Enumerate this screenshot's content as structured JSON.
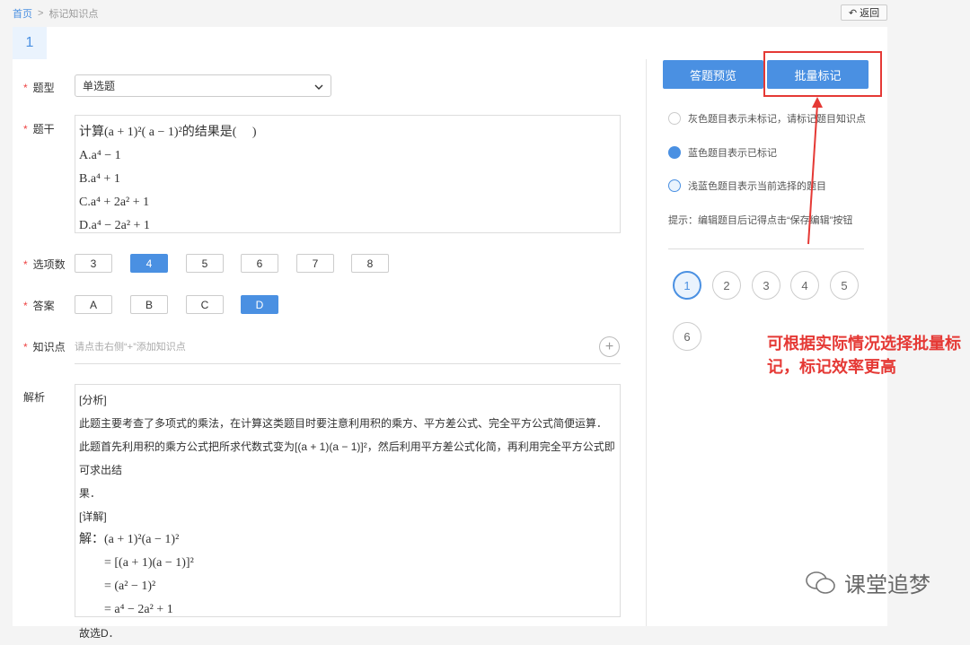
{
  "breadcrumb": {
    "home": "首页",
    "sep": ">",
    "current": "标记知识点"
  },
  "back_button": {
    "icon": "undo-icon",
    "label": "返回"
  },
  "question_tab": "1",
  "form": {
    "type": {
      "label": "题型",
      "value": "单选题"
    },
    "stem": {
      "label": "题干",
      "lines": [
        "计算(a + 1)²( a − 1)²的结果是(　 )",
        "A.a⁴ − 1",
        "B.a⁴ + 1",
        "C.a⁴ + 2a² + 1",
        "D.a⁴ − 2a² + 1"
      ]
    },
    "option_count": {
      "label": "选项数",
      "options": [
        "3",
        "4",
        "5",
        "6",
        "7",
        "8"
      ],
      "selected": "4"
    },
    "answer": {
      "label": "答案",
      "options": [
        "A",
        "B",
        "C",
        "D"
      ],
      "selected": "D"
    },
    "knowledge": {
      "label": "知识点",
      "placeholder": "请点击右侧“+”添加知识点"
    },
    "analysis": {
      "label": "解析",
      "lines": [
        "[分析]",
        "此题主要考查了多项式的乘法，在计算这类题目时要注意利用积的乘方、平方差公式、完全平方公式简便运算．",
        "此题首先利用积的乘方公式把所求代数式变为[(a + 1)(a − 1)]²，然后利用平方差公式化简，再利用完全平方公式即可求出结",
        "果．",
        "[详解]",
        "解：(a + 1)²(a − 1)²",
        "　　= [(a + 1)(a − 1)]²",
        "　　= (a² − 1)²",
        "　　= a⁴ − 2a² + 1",
        "故选D．"
      ]
    }
  },
  "actions": {
    "preview": "答题预览",
    "batch_mark": "批量标记"
  },
  "legend": [
    {
      "text": "灰色题目表示未标记，请标记题目知识点",
      "color": "#ffffff"
    },
    {
      "text": "蓝色题目表示已标记",
      "color": "#4a90e2"
    },
    {
      "text": "浅蓝色题目表示当前选择的题目",
      "color": "#eaf3fd"
    }
  ],
  "hint": "提示：编辑题目后记得点击“保存编辑”按钮",
  "question_numbers": [
    "1",
    "2",
    "3",
    "4",
    "5",
    "6"
  ],
  "current_question": "1",
  "annotation": "可根据实际情况选择批量标记，标记效率更高",
  "watermark": "课堂追梦",
  "colors": {
    "accent": "#4a90e2",
    "annotation_red": "#e53935",
    "required": "#ee4444"
  }
}
